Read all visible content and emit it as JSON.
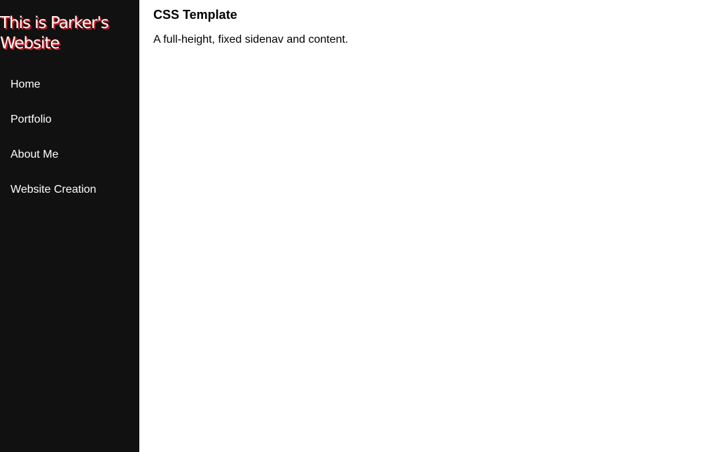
{
  "sidebar": {
    "title": "This is Parker's Website",
    "items": [
      {
        "label": "Home"
      },
      {
        "label": "Portfolio"
      },
      {
        "label": "About Me"
      },
      {
        "label": "Website Creation"
      }
    ],
    "background_color": "#111111",
    "title_shadow_color": "#e8141c"
  },
  "main": {
    "title": "CSS Template",
    "description": "A full-height, fixed sidenav and content."
  }
}
